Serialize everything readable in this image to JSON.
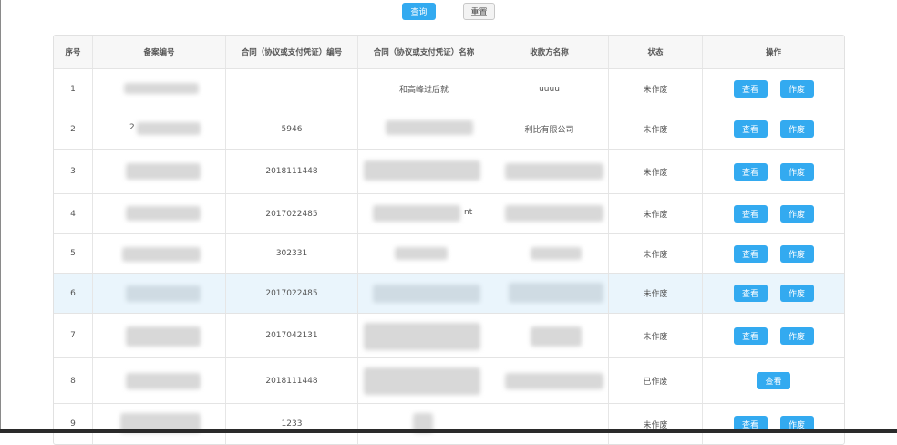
{
  "toolbar": {
    "search_label": "查询",
    "reset_label": "重置"
  },
  "table": {
    "headers": [
      "序号",
      "备案编号",
      "合同（协议或支付凭证）编号",
      "合同（协议或支付凭证）名称",
      "收款方名称",
      "状态",
      "操作"
    ],
    "rows": [
      {
        "no": "1",
        "filing_no": "",
        "contract_no": "",
        "contract_name": "和高峰过后就",
        "payee": "uuuu",
        "status": "未作废",
        "view": "查看",
        "void": "作废"
      },
      {
        "no": "2",
        "filing_no": "2",
        "contract_no": "5946",
        "contract_name": "",
        "payee": "利比有限公司",
        "status": "未作废",
        "view": "查看",
        "void": "作废"
      },
      {
        "no": "3",
        "filing_no": "",
        "contract_no": "2018111448",
        "contract_name": "",
        "payee": "",
        "status": "未作废",
        "view": "查看",
        "void": "作废"
      },
      {
        "no": "4",
        "filing_no": "",
        "contract_no": "2017022485",
        "contract_name": "nt",
        "payee": "",
        "status": "未作废",
        "view": "查看",
        "void": "作废"
      },
      {
        "no": "5",
        "filing_no": "",
        "contract_no": "302331",
        "contract_name": "",
        "payee": "",
        "status": "未作废",
        "view": "查看",
        "void": "作废"
      },
      {
        "no": "6",
        "filing_no": "",
        "contract_no": "2017022485",
        "contract_name": "",
        "payee": "",
        "status": "未作废",
        "view": "查看",
        "void": "作废"
      },
      {
        "no": "7",
        "filing_no": "",
        "contract_no": "2017042131",
        "contract_name": "",
        "payee": "",
        "status": "未作废",
        "view": "查看",
        "void": "作废"
      },
      {
        "no": "8",
        "filing_no": "",
        "contract_no": "2018111448",
        "contract_name": "",
        "payee": "",
        "status": "已作废",
        "view": "查看"
      },
      {
        "no": "9",
        "filing_no": "",
        "contract_no": "1233",
        "contract_name": "",
        "payee": "",
        "status": "未作废",
        "view": "查看",
        "void": "作废"
      }
    ]
  }
}
